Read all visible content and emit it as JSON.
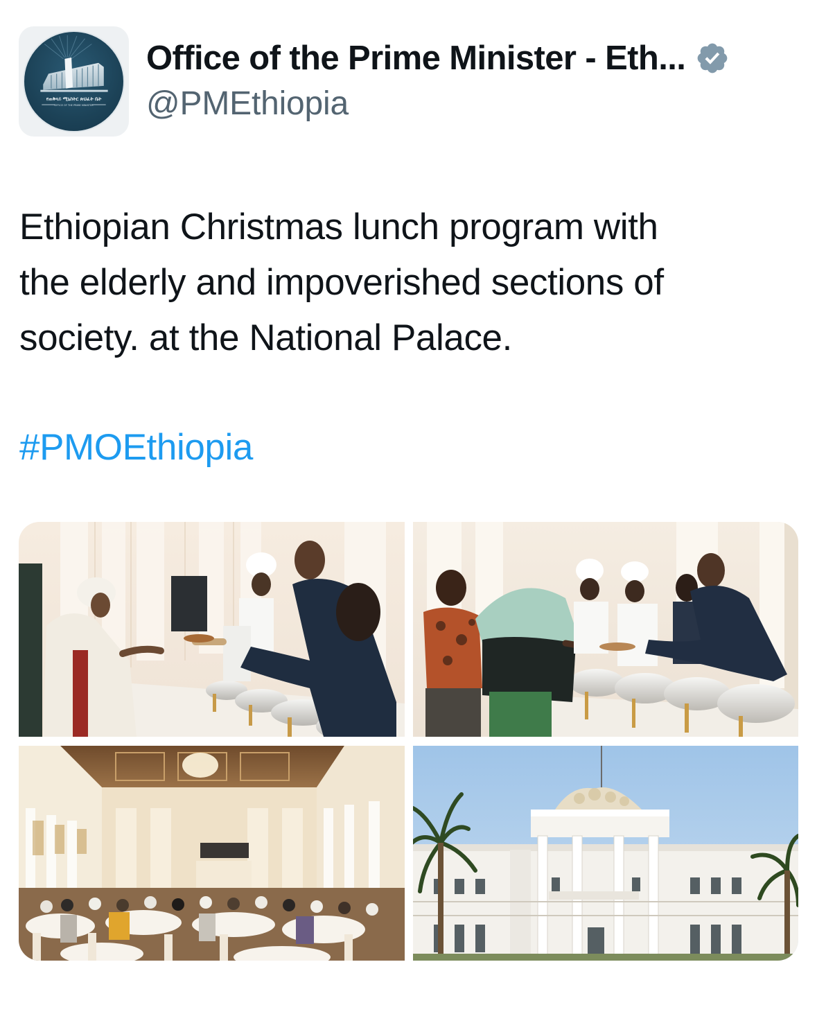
{
  "author": {
    "display_name": "Office of the Prime Minister - Eth...",
    "handle": "@PMEthiopia",
    "verified": true,
    "badge_color": "#829aab",
    "avatar_bg": "#1c4257",
    "avatar_text": {
      "amharic": "የጠቅላይ ሚኒስትር ጽህፈት ቤት",
      "english": "OFFICE OF THE PRIME MINISTER"
    }
  },
  "tweet": {
    "text_lines": [
      "Ethiopian Christmas lunch program with",
      "the elderly and impoverished sections of",
      "society. at the National Palace."
    ],
    "hashtag": "#PMOEthiopia",
    "link_color": "#1d9bf0"
  },
  "media": [
    {
      "index": 1,
      "subject": "lunch-serving-photo"
    },
    {
      "index": 2,
      "subject": "buffet-serving-photo"
    },
    {
      "index": 3,
      "subject": "banquet-hall-photo"
    },
    {
      "index": 4,
      "subject": "national-palace-photo"
    }
  ],
  "colors": {
    "text_primary": "#0f1419",
    "text_secondary": "#536471"
  }
}
